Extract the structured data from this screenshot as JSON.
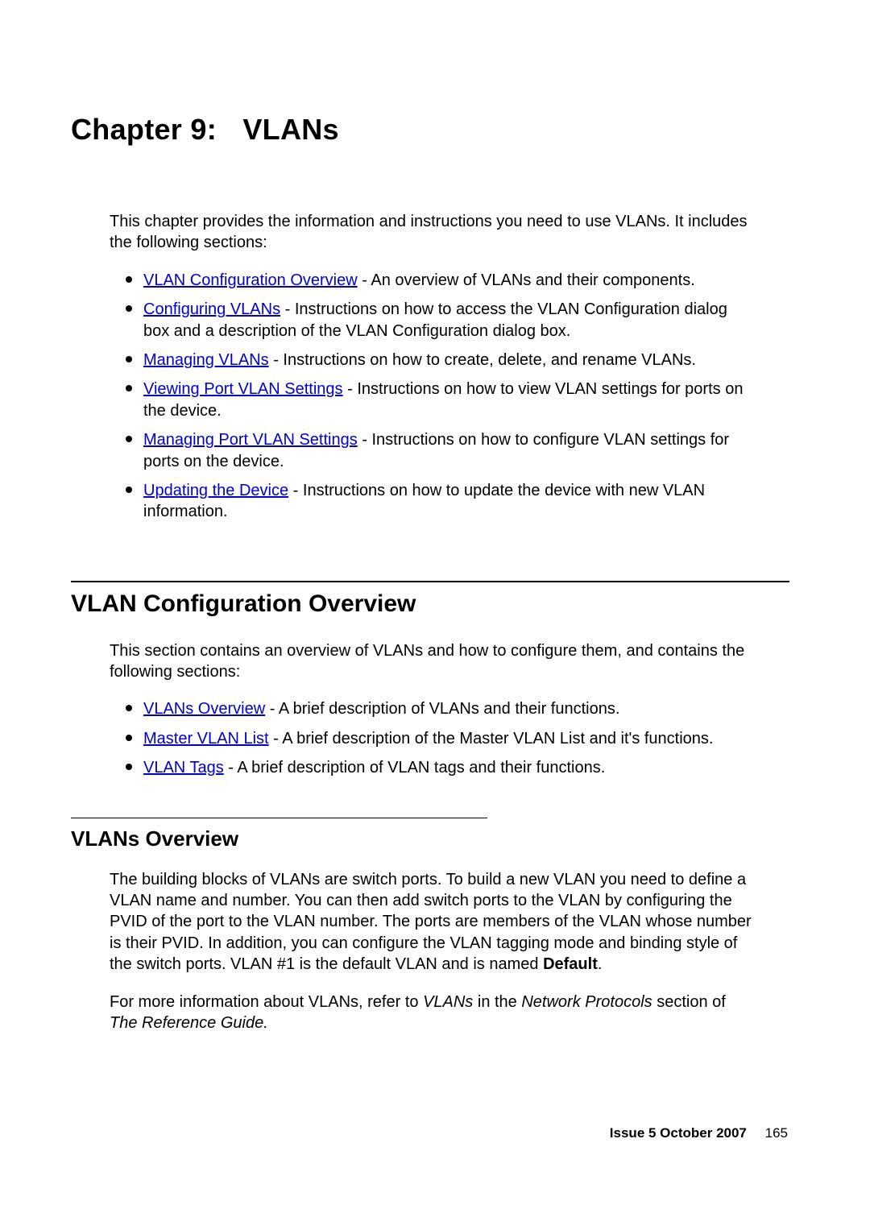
{
  "chapter": {
    "label": "Chapter 9:",
    "name": "VLANs"
  },
  "intro": "This chapter provides the information and instructions you need to use VLANs. It includes the following sections:",
  "toc": [
    {
      "link": "VLAN Configuration Overview",
      "desc": " - An overview of VLANs and their components."
    },
    {
      "link": "Configuring VLANs",
      "desc": " - Instructions on how to access the VLAN Configuration dialog box and a description of the VLAN Configuration dialog box."
    },
    {
      "link": "Managing VLANs",
      "desc": " - Instructions on how to create, delete, and rename VLANs."
    },
    {
      "link": "Viewing Port VLAN Settings",
      "desc": " - Instructions on how to view VLAN settings for ports on the device."
    },
    {
      "link": "Managing Port VLAN Settings",
      "desc": " - Instructions on how to configure VLAN settings for ports on the device."
    },
    {
      "link": "Updating the Device",
      "desc": " - Instructions on how to update the device with new VLAN information."
    }
  ],
  "section": {
    "title": "VLAN Configuration Overview",
    "intro": "This section contains an overview of VLANs and how to configure them, and contains the following sections:",
    "items": [
      {
        "link": "VLANs Overview",
        "desc": " - A brief description of VLANs and their functions."
      },
      {
        "link": "Master VLAN List",
        "desc": " - A brief description of the Master VLAN List and it's functions."
      },
      {
        "link": "VLAN Tags",
        "desc": " - A brief description of VLAN tags and their functions."
      }
    ]
  },
  "subsection": {
    "title": "VLANs Overview",
    "para1_pre": "The building blocks of VLANs are switch ports. To build a new VLAN you need to define a VLAN name and number. You can then add switch ports to the VLAN by configuring the PVID of the port to the VLAN number. The ports are members of the VLAN whose number is their PVID. In addition, you can configure the VLAN tagging mode and binding style of the switch ports. VLAN #1 is the default VLAN and is named ",
    "para1_bold": "Default",
    "para1_post": ".",
    "para2_pre": "For more information about VLANs, refer to ",
    "para2_i1": "VLANs",
    "para2_mid1": " in the ",
    "para2_i2": "Network Protocols",
    "para2_mid2": " section of ",
    "para2_i3": "The Reference Guide.",
    "para2_post": ""
  },
  "footer": {
    "issue": "Issue 5   October 2007",
    "pageno": "165"
  }
}
